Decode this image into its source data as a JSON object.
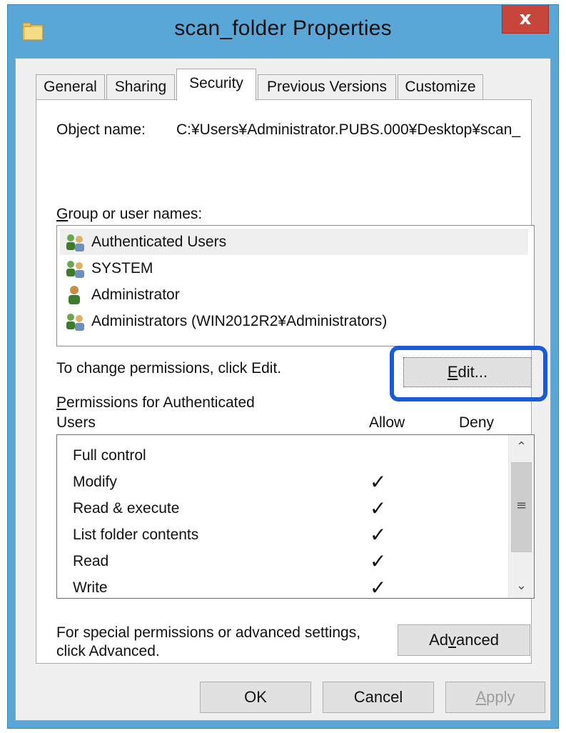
{
  "window": {
    "title": "scan_folder Properties",
    "close_glyph": "x",
    "title_icon": "folder-icon"
  },
  "tabs": [
    {
      "label": "General"
    },
    {
      "label": "Sharing"
    },
    {
      "label": "Security",
      "active": true
    },
    {
      "label": "Previous Versions"
    },
    {
      "label": "Customize"
    }
  ],
  "security": {
    "object_name_label": "Object name:",
    "object_name_value": "C:¥Users¥Administrator.PUBS.000¥Desktop¥scan_",
    "group_label": "Group or user names:",
    "users": [
      {
        "name": "Authenticated Users",
        "icon": "user-group-icon",
        "selected": true
      },
      {
        "name": "SYSTEM",
        "icon": "user-group-icon"
      },
      {
        "name": "Administrator",
        "icon": "user-icon"
      },
      {
        "name": "Administrators (WIN2012R2¥Administrators)",
        "icon": "user-group-icon"
      }
    ],
    "change_hint": "To change permissions, click Edit.",
    "edit_button": "Edit...",
    "permissions_label_line1": "Permissions for Authenticated",
    "permissions_label_line2": "Users",
    "allow_header": "Allow",
    "deny_header": "Deny",
    "permissions": [
      {
        "name": "Full control",
        "allow": false,
        "deny": false
      },
      {
        "name": "Modify",
        "allow": true,
        "deny": false
      },
      {
        "name": "Read & execute",
        "allow": true,
        "deny": false
      },
      {
        "name": "List folder contents",
        "allow": true,
        "deny": false
      },
      {
        "name": "Read",
        "allow": true,
        "deny": false
      },
      {
        "name": "Write",
        "allow": true,
        "deny": false
      }
    ],
    "check_glyph": "✓",
    "advanced_hint_line1": "For special permissions or advanced settings,",
    "advanced_hint_line2": "click Advanced.",
    "advanced_button": "Advanced"
  },
  "footer": {
    "ok": "OK",
    "cancel": "Cancel",
    "apply": "Apply"
  },
  "colors": {
    "window_frame": "#5aa6d6",
    "close_button": "#c7463c",
    "focus_highlight": "#1b5cd6"
  }
}
